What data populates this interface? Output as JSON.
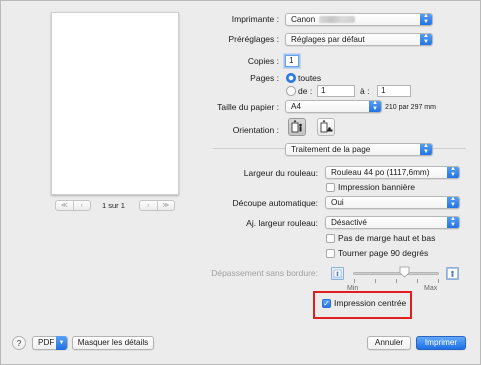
{
  "preview": {
    "page_indicator": "1 sur 1",
    "nav_first": "≪",
    "nav_prev": "‹",
    "nav_next": "›",
    "nav_last": "≫"
  },
  "printer": {
    "label": "Imprimante :",
    "value": "Canon"
  },
  "presets": {
    "label": "Préréglages :",
    "value": "Réglages par défaut"
  },
  "copies": {
    "label": "Copies :",
    "value": "1"
  },
  "pages": {
    "label": "Pages :",
    "all_label": "toutes",
    "from_label": "de :",
    "from_value": "1",
    "to_label": "à :",
    "to_value": "1"
  },
  "paper_size": {
    "label": "Taille du papier :",
    "value": "A4",
    "dimensions": "210 par 297 mm"
  },
  "orientation": {
    "label": "Orientation :",
    "selected": "portrait"
  },
  "section": {
    "value": "Traitement de la page"
  },
  "roll_width": {
    "label": "Largeur du rouleau:",
    "value": "Rouleau 44 po (1117,6mm)"
  },
  "banner": {
    "label": "Impression bannière",
    "checked": false
  },
  "auto_cut": {
    "label": "Découpe automatique:",
    "value": "Oui"
  },
  "fit_roll": {
    "label": "Aj. largeur rouleau:",
    "value": "Désactivé"
  },
  "no_margin": {
    "label": "Pas de marge haut et bas",
    "checked": false
  },
  "rotate": {
    "label": "Tourner page 90 degrés",
    "checked": false
  },
  "borderless": {
    "label": "Dépassement sans bordure:",
    "min_label": "Min",
    "max_label": "Max",
    "level": 0.6
  },
  "centered": {
    "label": "Impression centrée",
    "checked": true
  },
  "footer": {
    "help": "?",
    "pdf_label": "PDF",
    "hide_details": "Masquer les détails",
    "cancel": "Annuler",
    "print": "Imprimer"
  },
  "colors": {
    "accent": "#1e6fe6",
    "highlight": "#e02020"
  }
}
